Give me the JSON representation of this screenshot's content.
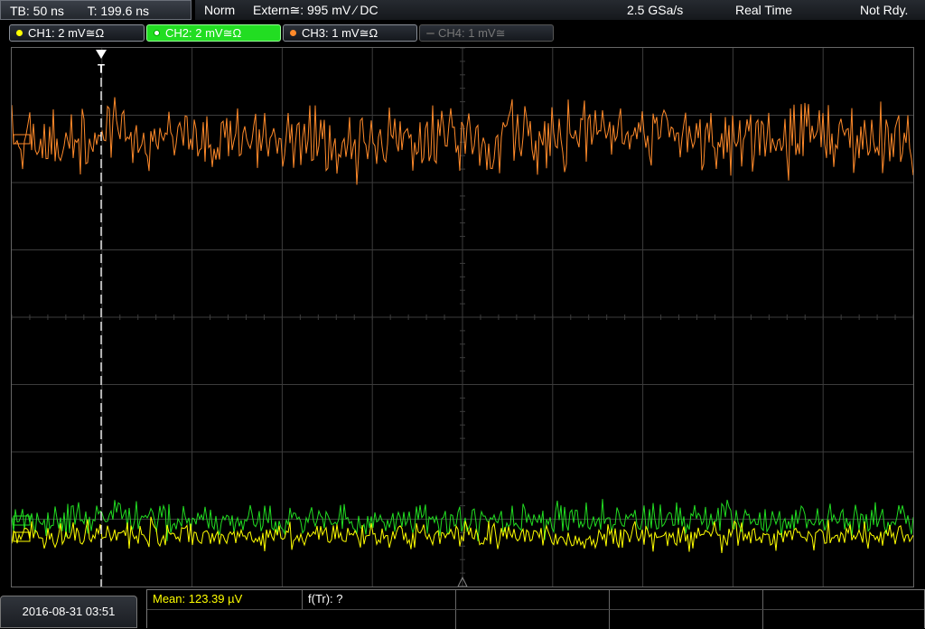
{
  "status": {
    "timebase": "TB: 50 ns",
    "trigger_time": "T: 199.6 ns",
    "mode": "Norm",
    "trigger_source": "Extern≅: 995 mV ⁄ DC",
    "sample_rate": "2.5 GSa/s",
    "acq_mode": "Real Time",
    "state": "Not Rdy."
  },
  "channels": [
    {
      "label": "CH1: 2 mV≅Ω",
      "color": "#ffff00",
      "state": "on"
    },
    {
      "label": "CH2: 2 mV≅Ω",
      "color": "#22dd22",
      "state": "active"
    },
    {
      "label": "CH3: 1 mV≅Ω",
      "color": "#ff8a2a",
      "state": "on"
    },
    {
      "label": "CH4: 1 mV≅",
      "color": "#666666",
      "state": "off"
    }
  ],
  "trigger_marker": "T",
  "datetime": "2016-08-31 03:51",
  "measurements": {
    "mean": "Mean: 123.39 µV",
    "freq": "f(Tr): ?"
  },
  "colors": {
    "ch1": "#ffff00",
    "ch2": "#22dd22",
    "ch3": "#ff8a2a",
    "grid": "#3c3c3c"
  }
}
